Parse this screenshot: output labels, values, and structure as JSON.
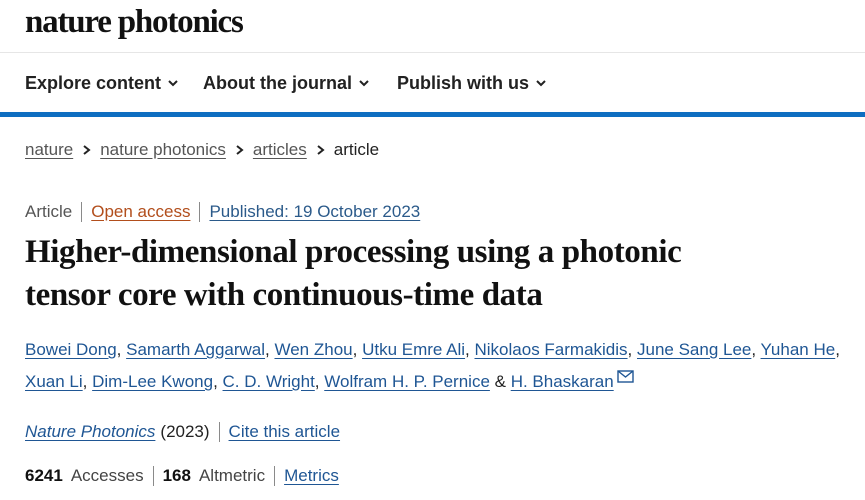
{
  "site": {
    "logo": "nature photonics"
  },
  "nav": {
    "items": [
      {
        "label": "Explore content",
        "icon": "chevron-down-icon"
      },
      {
        "label": "About the journal",
        "icon": "chevron-down-icon"
      },
      {
        "label": "Publish with us",
        "icon": "chevron-down-icon"
      }
    ]
  },
  "breadcrumb": {
    "items": [
      "nature",
      "nature photonics",
      "articles"
    ],
    "current": "article"
  },
  "article": {
    "type": "Article",
    "access": "Open access",
    "published": "Published: 19 October 2023",
    "title_line1": "Higher-dimensional processing using a photonic",
    "title_line2": "tensor core with continuous-time data",
    "authors": [
      "Bowei Dong",
      "Samarth Aggarwal",
      "Wen Zhou",
      "Utku Emre Ali",
      "Nikolaos Farmakidis",
      "June Sang Lee",
      "Yuhan He",
      "Xuan Li",
      "Dim-Lee Kwong",
      "C. D. Wright",
      "Wolfram H. P. Pernice",
      "H. Bhaskaran"
    ],
    "author_separator": ",",
    "author_and": "&",
    "journal": "Nature Photonics",
    "year": "(2023)",
    "cite_label": "Cite this article",
    "accesses_count": "6241",
    "accesses_label": "Accesses",
    "altmetric_count": "168",
    "altmetric_label": "Altmetric",
    "metrics_label": "Metrics"
  },
  "colors": {
    "accent_blue": "#0e6ec1",
    "link_blue": "#1f5694",
    "open_access": "#b24e1c"
  }
}
